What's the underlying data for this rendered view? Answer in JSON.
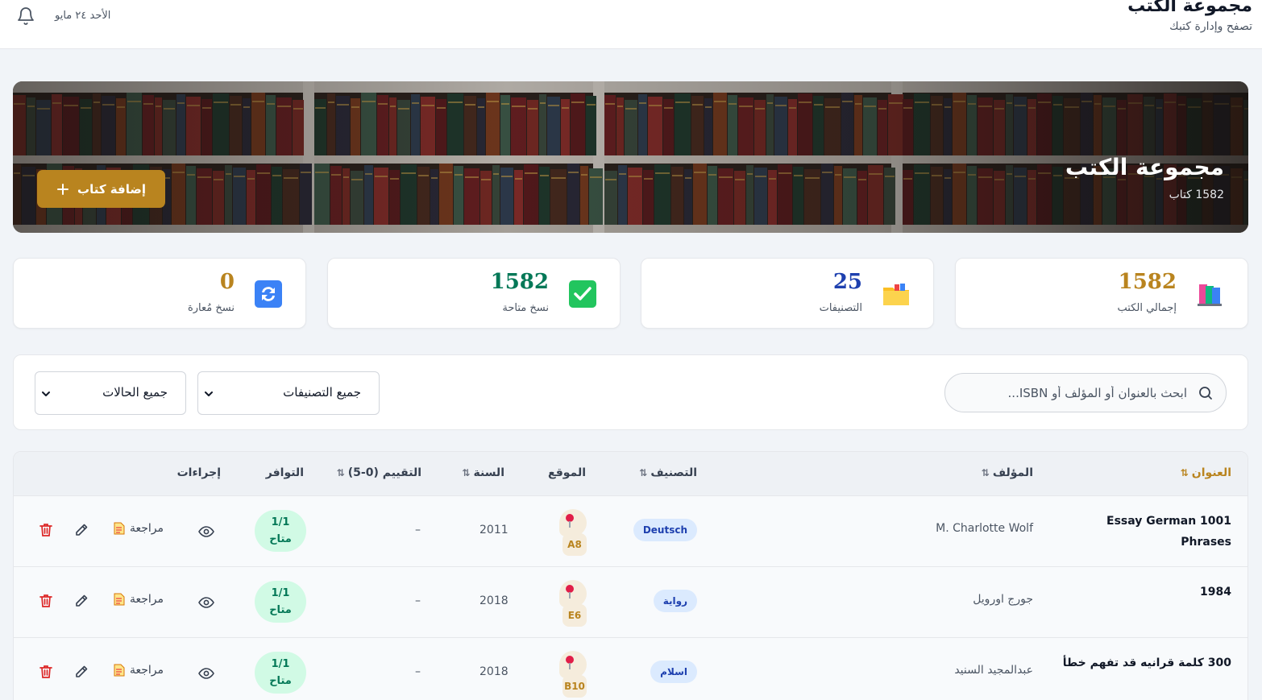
{
  "header": {
    "title": "مجموعة الكتب",
    "subtitle": "تصفح وإدارة كتبك",
    "date": "الأحد ٢٤ مايو"
  },
  "hero": {
    "title": "مجموعة الكتب",
    "count_text": "1582 كتاب",
    "add_button_label": "إضافة كتاب"
  },
  "stats": [
    {
      "label": "إجمالي الكتب",
      "value": "1582",
      "color": "#b9841f",
      "icon": "books-icon"
    },
    {
      "label": "التصنيفات",
      "value": "25",
      "color": "#1e40af",
      "icon": "folder-icon"
    },
    {
      "label": "نسخ متاحة",
      "value": "1582",
      "color": "#047857",
      "icon": "check-icon"
    },
    {
      "label": "نسخ مُعارة",
      "value": "0",
      "color": "#b9841f",
      "icon": "refresh-icon"
    }
  ],
  "filters": {
    "search_placeholder": "ابحث بالعنوان أو المؤلف أو ISBN...",
    "category_select": "جميع التصنيفات",
    "status_select": "جميع الحالات"
  },
  "table": {
    "headers": {
      "title": "العنوان",
      "author": "المؤلف",
      "category": "التصنيف",
      "location": "الموقع",
      "year": "السنة",
      "rating": "التقييم (0-5)",
      "availability": "التوافر",
      "actions": "إجراءات"
    },
    "sort_icon": "⇅",
    "review_label": "مراجعة",
    "rows": [
      {
        "title": "Essay German 1001 Phrases",
        "author": "M. Charlotte Wolf",
        "category": "Deutsch",
        "location": "A8",
        "year": "2011",
        "rating": "–",
        "avail_count": "1/1",
        "avail_status": "متاح"
      },
      {
        "title": "1984",
        "author": "جورج اورويل",
        "category": "رواية",
        "location": "E6",
        "year": "2018",
        "rating": "–",
        "avail_count": "1/1",
        "avail_status": "متاح"
      },
      {
        "title": "300 كلمة قرانيه قد تفهم خطأ",
        "author": "عبدالمجيد السنيد",
        "category": "اسلام",
        "location": "B10",
        "year": "2018",
        "rating": "–",
        "avail_count": "1/1",
        "avail_status": "متاح"
      }
    ]
  }
}
